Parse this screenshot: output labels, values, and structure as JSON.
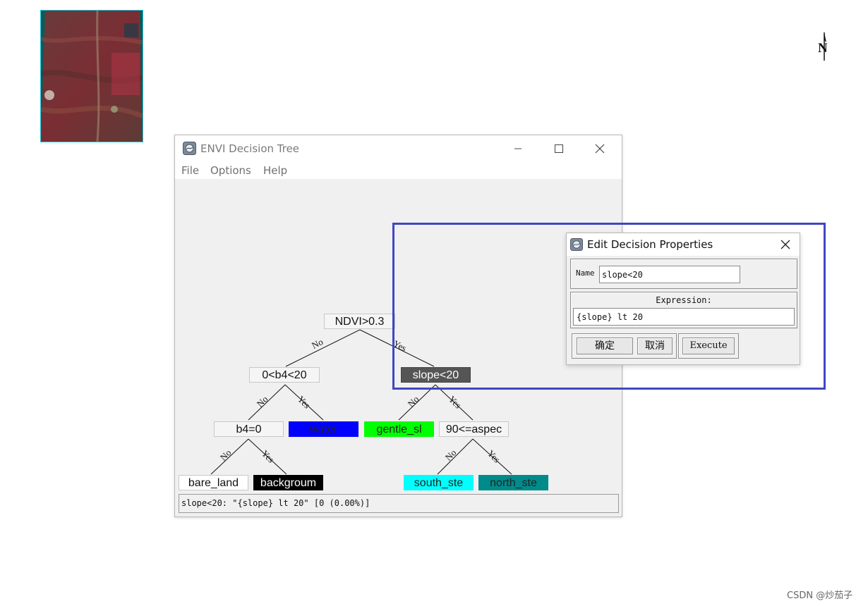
{
  "thumbnail": {
    "description_icon": "satellite-image-thumbnail"
  },
  "north_arrow": {
    "label": "N"
  },
  "envi_window": {
    "title": "ENVI Decision Tree",
    "menu": [
      "File",
      "Options",
      "Help"
    ],
    "tree": {
      "nodes": [
        {
          "id": "ndvi",
          "label": "NDVI>0.3",
          "type": "decision",
          "bg": "#f5f5f5",
          "fg": "#111111"
        },
        {
          "id": "b4range",
          "label": "0<b4<20",
          "type": "decision",
          "bg": "#f5f5f5",
          "fg": "#111111"
        },
        {
          "id": "slope",
          "label": "slope<20",
          "type": "decision",
          "bg": "#555555",
          "fg": "#ffffff"
        },
        {
          "id": "b4zero",
          "label": "b4=0",
          "type": "decision",
          "bg": "#f5f5f5",
          "fg": "#111111"
        },
        {
          "id": "water",
          "label": "water",
          "type": "class",
          "bg": "#0000ff",
          "fg": "#222222"
        },
        {
          "id": "gentle",
          "label": "gentle_sl",
          "type": "class",
          "bg": "#00ff00",
          "fg": "#222222"
        },
        {
          "id": "aspect",
          "label": "90<=aspec",
          "type": "decision",
          "bg": "#f5f5f5",
          "fg": "#111111"
        },
        {
          "id": "bare",
          "label": "bare_land",
          "type": "class",
          "bg": "#ffffff",
          "fg": "#111111"
        },
        {
          "id": "background",
          "label": "backgroum",
          "type": "class",
          "bg": "#000000",
          "fg": "#ffffff"
        },
        {
          "id": "south",
          "label": "south_ste",
          "type": "class",
          "bg": "#00ffff",
          "fg": "#222222"
        },
        {
          "id": "north",
          "label": "north_ste",
          "type": "class",
          "bg": "#008b8b",
          "fg": "#222222"
        }
      ],
      "edge_no": "No",
      "edge_yes": "Yes"
    },
    "status": "slope<20: \"{slope} lt 20\" [0 (0.00%)]"
  },
  "dialog": {
    "title": "Edit Decision Properties",
    "name_label": "Name",
    "name_value": "slope<20",
    "expression_label": "Expression:",
    "expression_value": "{slope} lt 20",
    "ok_label": "确定",
    "cancel_label": "取消",
    "execute_label": "Execute"
  },
  "highlight_color": "#3f47c2",
  "watermark": "CSDN @炒茄子"
}
